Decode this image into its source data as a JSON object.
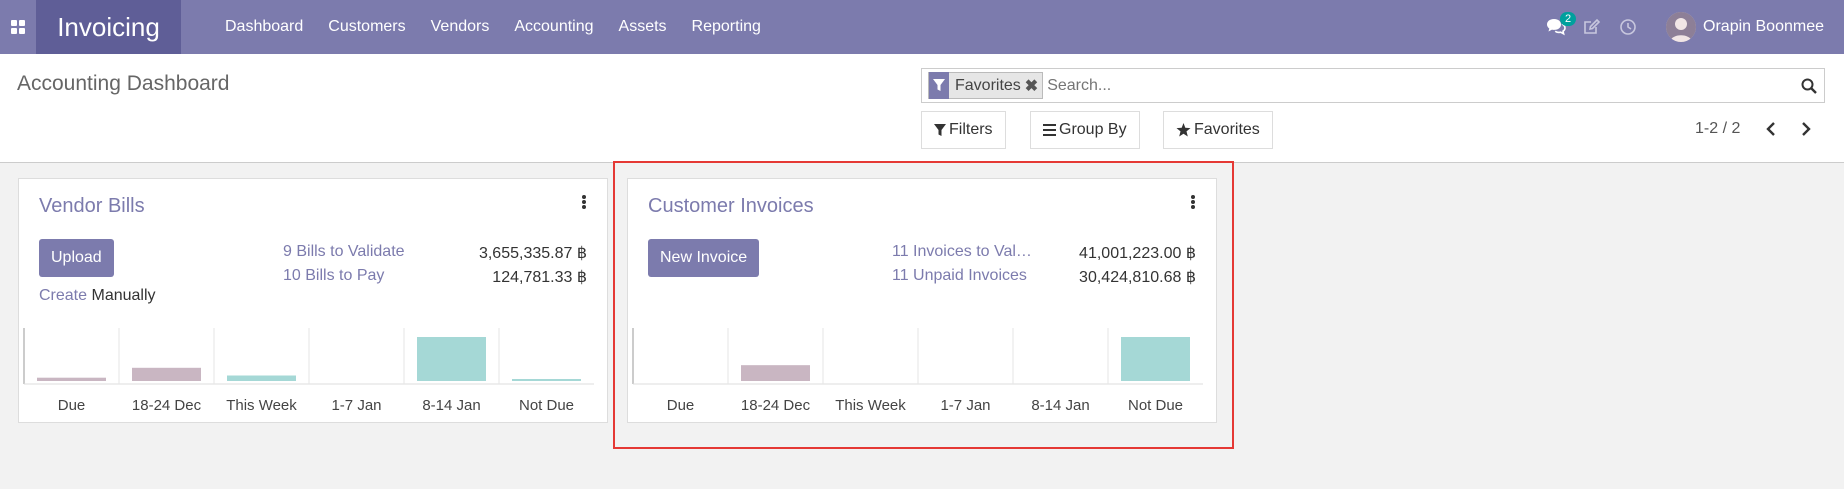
{
  "nav": {
    "app_title": "Invoicing",
    "menu": [
      "Dashboard",
      "Customers",
      "Vendors",
      "Accounting",
      "Assets",
      "Reporting"
    ],
    "chat_badge": "2",
    "user_name": "Orapin Boonmee",
    "icons": [
      "apps-grid-icon",
      "chat-icon",
      "edit-icon",
      "clock-icon"
    ],
    "color": "#7c7bad"
  },
  "control_panel": {
    "title": "Accounting Dashboard",
    "search": {
      "facet": "Favorites",
      "placeholder": "Search..."
    },
    "filters_label": "Filters",
    "group_by_label": "Group By",
    "favorites_label": "Favorites",
    "pager": "1-2 / 2"
  },
  "cards": [
    {
      "title": "Vendor Bills",
      "button": "Upload",
      "create_link": "Create",
      "create_suffix": "Manually",
      "stats": [
        {
          "label": "9 Bills to Validate",
          "value": "3,655,335.87 ฿"
        },
        {
          "label": "10 Bills to Pay",
          "value": "124,781.33 ฿"
        }
      ],
      "chart_data": {
        "type": "bar",
        "categories": [
          "Due",
          "18-24 Dec",
          "This Week",
          "1-7 Jan",
          "8-14 Jan",
          "Not Due"
        ],
        "values": [
          3,
          12,
          5,
          0,
          40,
          1
        ],
        "colors": [
          "#c9b6c2",
          "#c9b6c2",
          "#a5d8d6",
          "#a5d8d6",
          "#a5d8d6",
          "#a5d8d6"
        ]
      }
    },
    {
      "title": "Customer Invoices",
      "button": "New Invoice",
      "stats": [
        {
          "label": "11 Invoices to Val…",
          "value": "41,001,223.00 ฿"
        },
        {
          "label": "11 Unpaid Invoices",
          "value": "30,424,810.68 ฿"
        }
      ],
      "chart_data": {
        "type": "bar",
        "categories": [
          "Due",
          "18-24 Dec",
          "This Week",
          "1-7 Jan",
          "8-14 Jan",
          "Not Due"
        ],
        "values": [
          0,
          18,
          0,
          0,
          0,
          50
        ],
        "colors": [
          "#c9b6c2",
          "#c9b6c2",
          "#a5d8d6",
          "#a5d8d6",
          "#a5d8d6",
          "#a5d8d6"
        ]
      }
    }
  ]
}
